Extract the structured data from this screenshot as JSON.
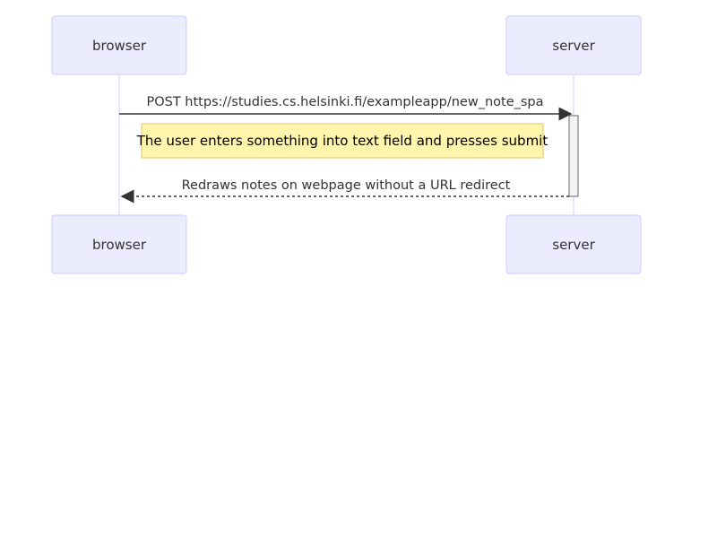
{
  "actors": {
    "browser": "browser",
    "server": "server"
  },
  "messages": [
    {
      "text": "POST https://studies.cs.helsinki.fi/exampleapp/new_note_spa",
      "style": "solid",
      "direction": "browser-to-server"
    },
    {
      "text": "Redraws notes on webpage without a URL redirect",
      "style": "dotted",
      "direction": "server-to-browser"
    }
  ],
  "note": {
    "text": "The user enters something into text field and presses submit"
  },
  "colors": {
    "actor_fill": "#ececff",
    "actor_stroke": "#ccccff",
    "lifeline": "#ccccff",
    "arrow": "#333333",
    "note_fill": "#fff5ad",
    "note_stroke": "#d9c66c",
    "activation_fill": "#f4f4f4",
    "activation_stroke": "#666666"
  }
}
